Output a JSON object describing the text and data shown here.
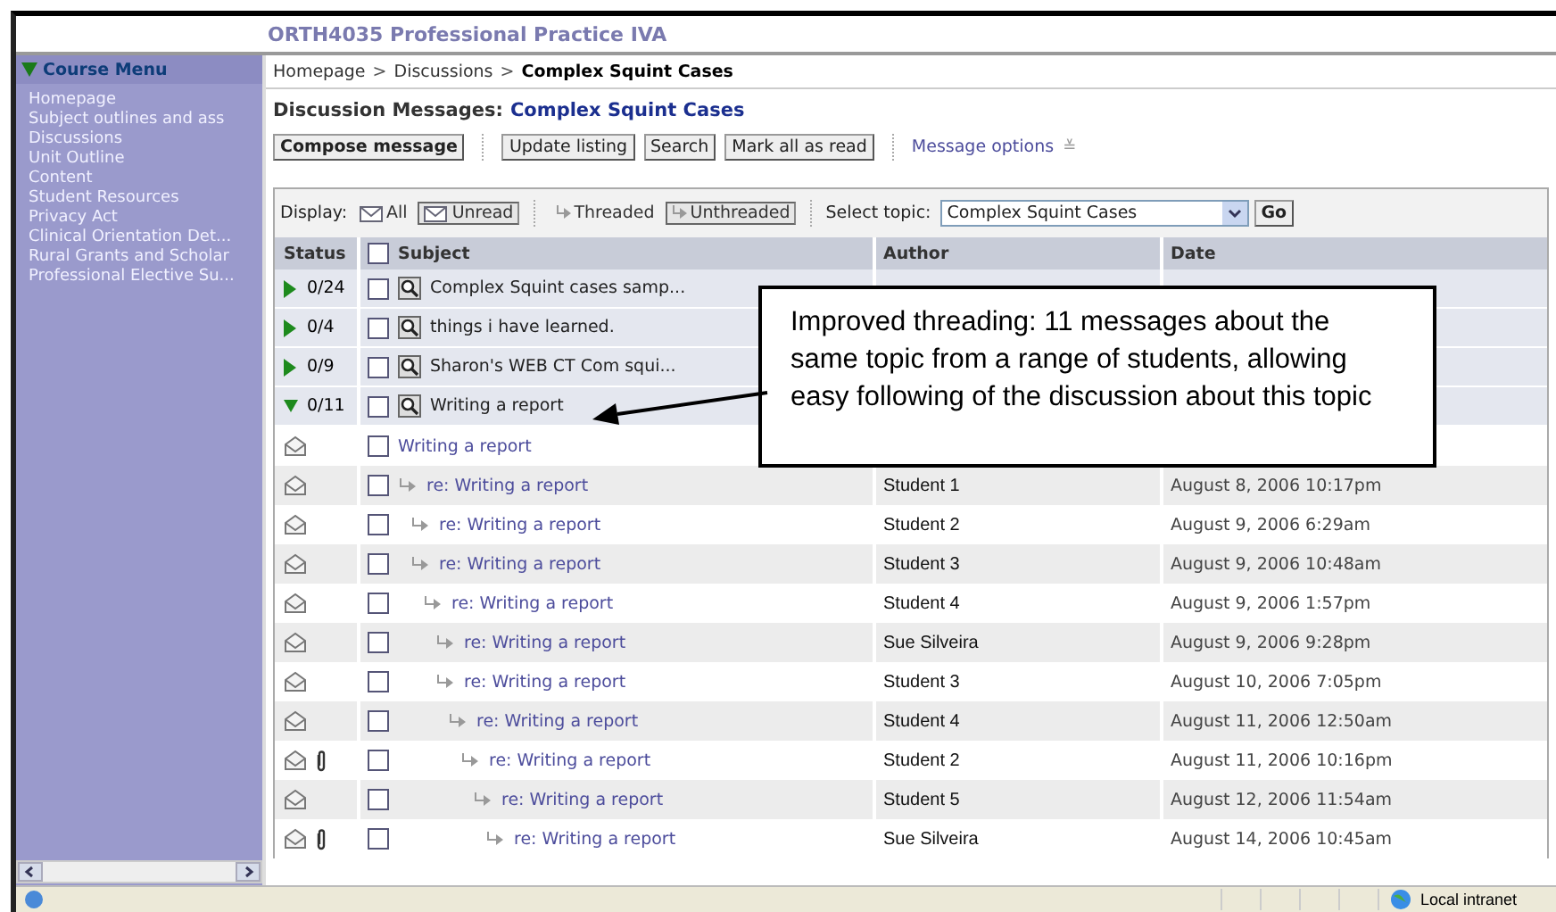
{
  "course_title": "ORTH4035 Professional Practice IVA",
  "sidebar": {
    "heading": "Course Menu",
    "expanded": true,
    "items": [
      "Homepage",
      "Subject outlines and ass",
      "Discussions",
      "Unit Outline",
      "Content",
      "Student Resources",
      "Privacy Act",
      "Clinical Orientation Det...",
      "Rural Grants and Scholar",
      "Professional Elective Su..."
    ]
  },
  "breadcrumb": [
    {
      "label": "Homepage",
      "current": false
    },
    {
      "label": "Discussions",
      "current": false
    },
    {
      "label": "Complex Squint Cases",
      "current": true
    }
  ],
  "breadcrumb_separator": ">",
  "heading": {
    "label": "Discussion Messages:",
    "topic": "Complex Squint Cases"
  },
  "toolbar": {
    "primary": "Compose message",
    "buttons": [
      "Update listing",
      "Search",
      "Mark all as read"
    ],
    "options_link": "Message options",
    "options_glyph": "≚"
  },
  "display_bar": {
    "label": "Display:",
    "filters": [
      {
        "label": "All",
        "selected": false
      },
      {
        "label": "Unread",
        "selected": true
      }
    ],
    "modes": [
      {
        "label": "Threaded",
        "selected": false
      },
      {
        "label": "Unthreaded",
        "selected": true
      }
    ],
    "topic_label": "Select topic:",
    "topic_value": "Complex Squint Cases",
    "go": "Go"
  },
  "table": {
    "columns": [
      "Status",
      "Subject",
      "Author",
      "Date"
    ],
    "select_all_checked": false,
    "threads": [
      {
        "status": "0/24",
        "expanded": false,
        "checked": false,
        "subject": "Complex Squint cases samp..."
      },
      {
        "status": "0/4",
        "expanded": false,
        "checked": false,
        "subject": "things i have learned."
      },
      {
        "status": "0/9",
        "expanded": false,
        "checked": false,
        "subject": "Sharon's WEB CT Com squi..."
      },
      {
        "status": "0/11",
        "expanded": true,
        "checked": false,
        "subject": "Writing a report",
        "messages": [
          {
            "subject": "Writing a report",
            "attachment": false,
            "checked": false,
            "children": [
              {
                "subject": "re: Writing a report",
                "author": "Student 1",
                "date": "August 8, 2006 10:17pm",
                "attachment": false,
                "checked": false,
                "children": [
                  {
                    "subject": "re: Writing a report",
                    "author": "Student 2",
                    "date": "August 9, 2006 6:29am",
                    "attachment": false,
                    "checked": false
                  },
                  {
                    "subject": "re: Writing a report",
                    "author": "Student 3",
                    "date": "August 9, 2006 10:48am",
                    "attachment": false,
                    "checked": false,
                    "children": [
                      {
                        "subject": "re: Writing a report",
                        "author": "Student 4",
                        "date": "August 9, 2006 1:57pm",
                        "attachment": false,
                        "checked": false,
                        "children": [
                          {
                            "subject": "re: Writing a report",
                            "author": "Sue Silveira",
                            "date": "August 9, 2006 9:28pm",
                            "attachment": false,
                            "checked": false
                          },
                          {
                            "subject": "re: Writing a report",
                            "author": "Student 3",
                            "date": "August 10, 2006 7:05pm",
                            "attachment": false,
                            "checked": false,
                            "children": [
                              {
                                "subject": "re: Writing a report",
                                "author": "Student 4",
                                "date": "August 11, 2006 12:50am",
                                "attachment": false,
                                "checked": false,
                                "children": [
                                  {
                                    "subject": "re: Writing a report",
                                    "author": "Student 2",
                                    "date": "August 11, 2006 10:16pm",
                                    "attachment": true,
                                    "checked": false,
                                    "children": [
                                      {
                                        "subject": "re: Writing a report",
                                        "author": "Student 5",
                                        "date": "August 12, 2006 11:54am",
                                        "attachment": false,
                                        "checked": false,
                                        "children": [
                                          {
                                            "subject": "re: Writing a report",
                                            "author": "Sue Silveira",
                                            "date": "August 14, 2006 10:45am",
                                            "attachment": true,
                                            "checked": false
                                          }
                                        ]
                                      }
                                    ]
                                  }
                                ]
                              }
                            ]
                          }
                        ]
                      }
                    ]
                  }
                ]
              }
            ]
          }
        ]
      }
    ]
  },
  "callout": "Improved threading: 11 messages about the same topic from a range of students, allowing easy following of the discussion about this topic",
  "status_bar": {
    "zone": "Local intranet"
  }
}
